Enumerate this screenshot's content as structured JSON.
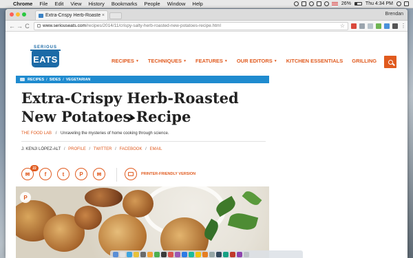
{
  "menubar": {
    "apple": "",
    "app": "Chrome",
    "items": [
      "File",
      "Edit",
      "View",
      "History",
      "Bookmarks",
      "People",
      "Window",
      "Help"
    ],
    "battery": "26%",
    "clock": "Thu 4:34 PM"
  },
  "browser": {
    "tab_title": "Extra-Crispy Herb-Roasted Ne",
    "tab_close": "×",
    "profile_name": "Brendan",
    "url_host": "www.seriouseats.com",
    "url_path": "/recipes/2014/11/crispy-salty-herb-roasted-new-potatoes-recipe.html",
    "back": "←",
    "forward": "→",
    "reload": "C",
    "bookmark_star": "☆",
    "menu": "⋮"
  },
  "site": {
    "logo_top": "SERIOUS",
    "logo_main": "EATS",
    "nav": [
      {
        "label": "RECIPES",
        "caret": "▼"
      },
      {
        "label": "TECHNIQUES",
        "caret": "▼"
      },
      {
        "label": "FEATURES",
        "caret": "▼"
      },
      {
        "label": "OUR EDITORS",
        "caret": "▼"
      },
      {
        "label": "KITCHEN ESSENTIALS",
        "caret": ""
      },
      {
        "label": "GRILLING",
        "caret": ""
      }
    ],
    "accent_color": "#e05a1e",
    "brand_blue": "#1c6aa6"
  },
  "breadcrumb": {
    "items": [
      "RECIPES",
      "SIDES",
      "VEGETARIAN"
    ],
    "sep": "/"
  },
  "article": {
    "title": "Extra-Crispy Herb-Roasted New Potatoes Recipe",
    "series": "THE FOOD LAB",
    "series_sep": "/",
    "series_tagline": "Unraveling the mysteries of home cooking through science.",
    "author": "J. KENJI LÓPEZ-ALT",
    "byline_links": [
      "PROFILE",
      "TWITTER",
      "FACEBOOK",
      "EMAIL"
    ],
    "byline_sep": "/",
    "comment_count": "22",
    "share_icons": {
      "comments": "✉",
      "facebook": "f",
      "twitter": "t",
      "pinterest": "P",
      "email": "✉"
    },
    "print_label": "PRINTER-FRIENDLY VERSION",
    "hero_pin": "P"
  }
}
